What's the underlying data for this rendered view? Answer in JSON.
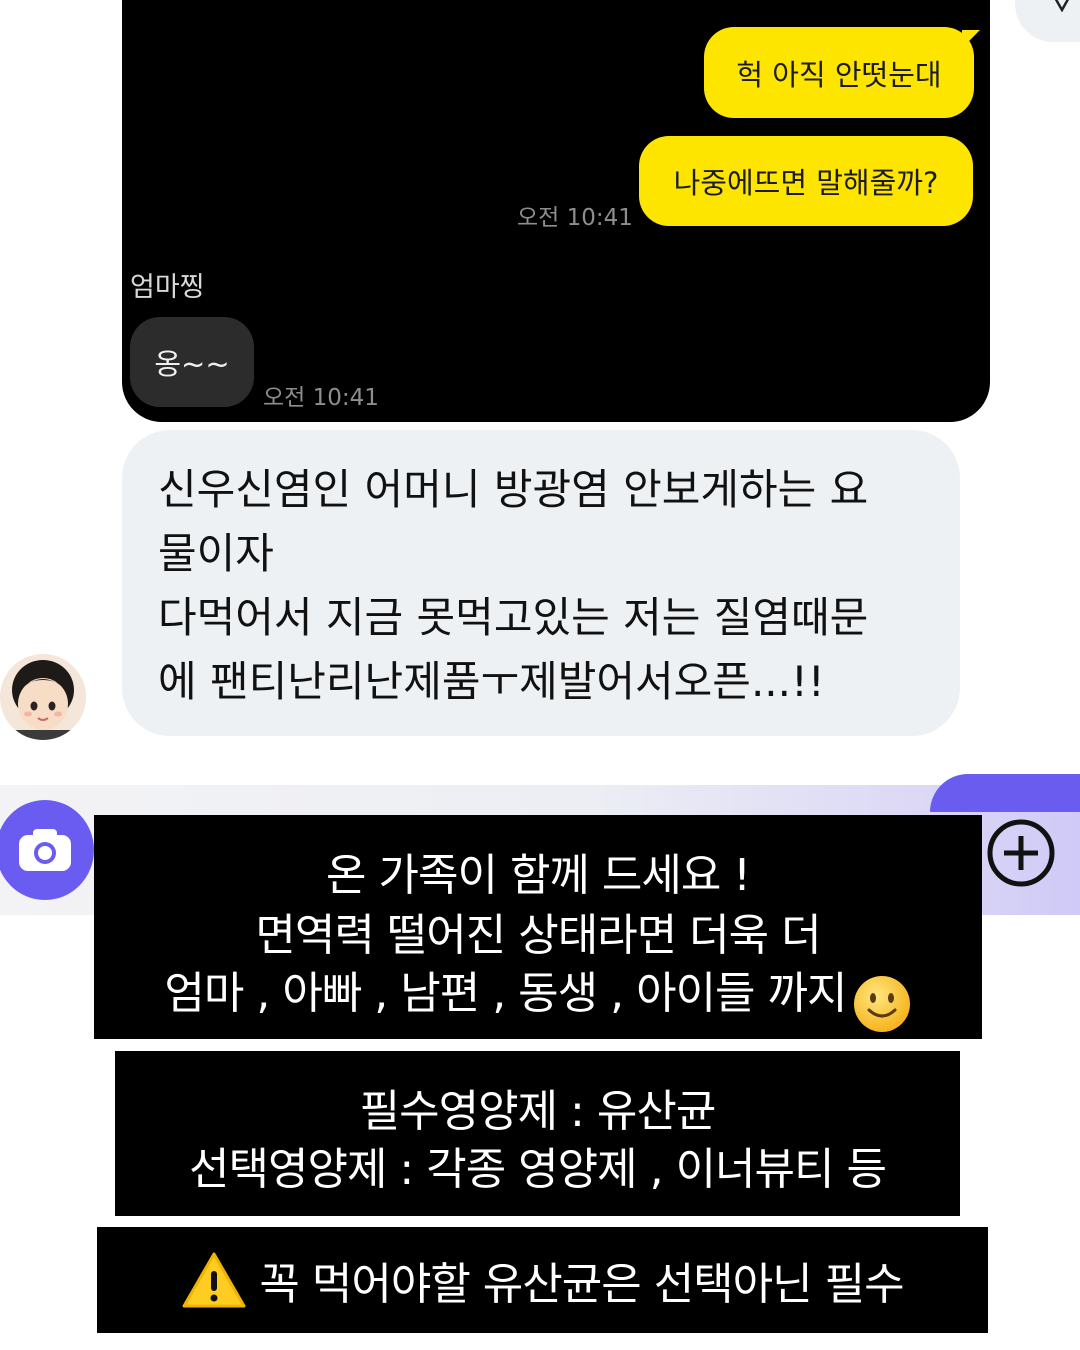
{
  "chat": {
    "messages_sent": [
      {
        "text": "헉 아직 안떳눈대"
      },
      {
        "text": "나중에뜨면 말해줄까?"
      }
    ],
    "sent_time": "오전 10:41",
    "sender_name": "엄마찡",
    "received": {
      "text": "옹~~"
    },
    "received_time": "오전 10:41"
  },
  "comment": {
    "lines": [
      "신우신염인 어머니 방광염 안보게하는 요",
      "물이자",
      "다먹어서 지금 못먹고있는 저는 질염때문",
      "에 팬티난리난제품ㅜ제발어서오픈...!!"
    ]
  },
  "captions": {
    "box1": [
      "온 가족이 함께 드세요 !",
      "면역력 떨어진 상태라면 더욱 더",
      "엄마 , 아빠 , 남편 , 동생 , 아이들 까지"
    ],
    "box2": [
      "필수영양제 : 유산균",
      "선택영양제 : 각종 영양제 , 이너뷰티 등"
    ],
    "box3": "꼭 먹어야할 유산균은 선택아닌 필수"
  },
  "icons": {
    "camera": "camera-icon",
    "plus": "plus-circle-icon",
    "smile": "smiling-face-emoji",
    "warning": "warning-sign-emoji",
    "avatar": "girl-avatar-icon"
  },
  "colors": {
    "kakao_yellow": "#fee500",
    "accent_purple": "#6a5cf0",
    "comment_bg": "#eef1f4"
  }
}
